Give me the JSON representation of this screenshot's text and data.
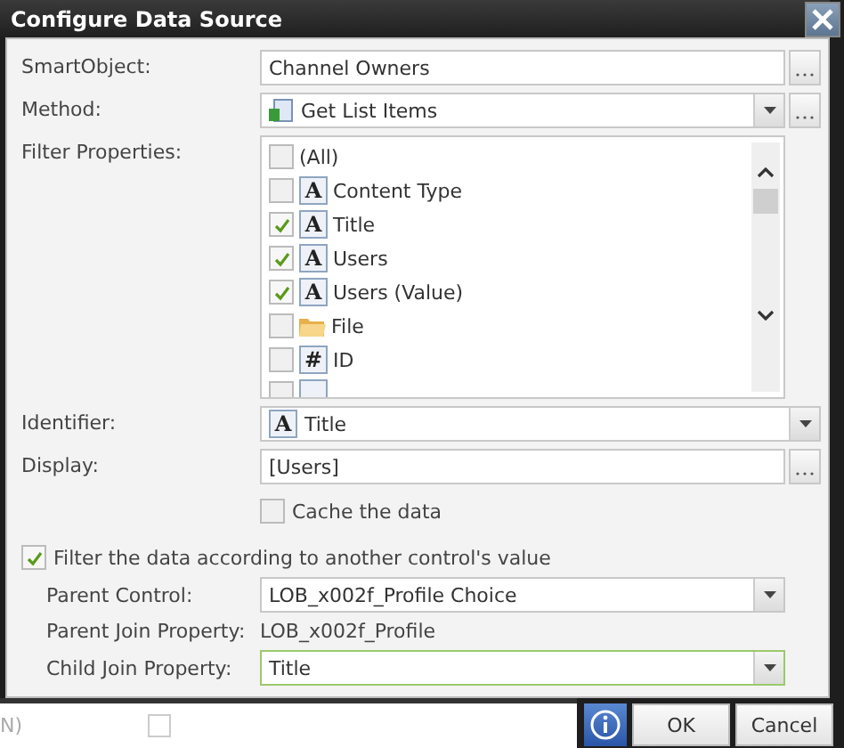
{
  "window": {
    "title": "Configure Data Source"
  },
  "fields": {
    "smartobject": {
      "label": "SmartObject:",
      "value": "Channel Owners"
    },
    "method": {
      "label": "Method:",
      "value": "Get List Items"
    },
    "filter_properties": {
      "label": "Filter Properties:",
      "items": [
        {
          "kind": "none",
          "label": "(All)",
          "checked": false
        },
        {
          "kind": "text",
          "glyph": "A",
          "label": "Content Type",
          "checked": false
        },
        {
          "kind": "text",
          "glyph": "A",
          "label": "Title",
          "checked": true
        },
        {
          "kind": "text",
          "glyph": "A",
          "label": "Users",
          "checked": true
        },
        {
          "kind": "text",
          "glyph": "A",
          "label": "Users (Value)",
          "checked": true
        },
        {
          "kind": "file",
          "label": "File",
          "checked": false
        },
        {
          "kind": "number",
          "glyph": "#",
          "label": "ID",
          "checked": false
        },
        {
          "kind": "text",
          "checked": false
        }
      ]
    },
    "identifier": {
      "label": "Identifier:",
      "glyph": "A",
      "value": "Title"
    },
    "display": {
      "label": "Display:",
      "value": "[Users]"
    },
    "cache": {
      "label": "Cache the data",
      "checked": false
    }
  },
  "filter": {
    "label": "Filter the data according to another control's value",
    "checked": true,
    "parent_control": {
      "label": "Parent Control:",
      "value": "LOB_x002f_Profile Choice"
    },
    "parent_join": {
      "label": "Parent Join Property:",
      "value": "LOB_x002f_Profile"
    },
    "child_join": {
      "label": "Child Join Property:",
      "value": "Title"
    }
  },
  "buttons": [
    "OK",
    "Cancel"
  ],
  "background": {
    "text": "N)",
    "checked": false
  }
}
